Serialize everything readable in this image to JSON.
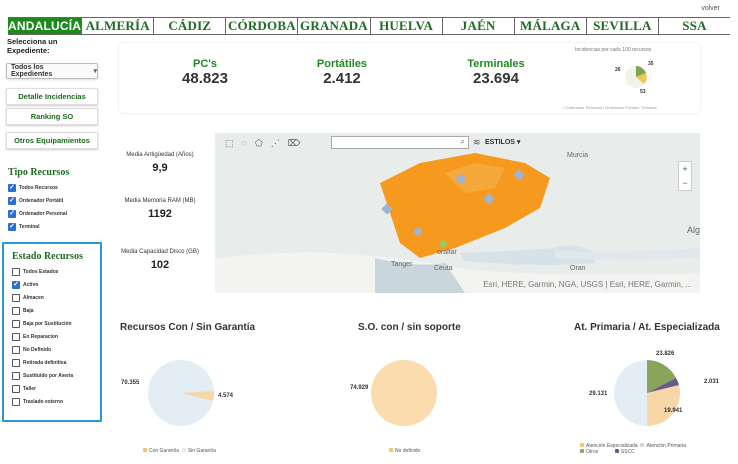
{
  "header": {
    "volver": "volver"
  },
  "tabs": [
    {
      "label": "ANDALUCÍA",
      "active": true
    },
    {
      "label": "ALMERÍA"
    },
    {
      "label": "CÁDIZ"
    },
    {
      "label": "CÓRDOBA"
    },
    {
      "label": "GRANADA"
    },
    {
      "label": "HUELVA"
    },
    {
      "label": "JAÉN"
    },
    {
      "label": "MÁLAGA"
    },
    {
      "label": "SEVILLA"
    },
    {
      "label": "SSA"
    }
  ],
  "sidebar": {
    "expediente_label": "Selecciona un Expediente:",
    "expediente_value": "Todos los Expedientes",
    "buttons": [
      "Detalle Incidencias",
      "Ranking SO",
      "Otros Equipamientos"
    ],
    "tipo_title": "Tipo Recursos",
    "tipo_items": [
      "Todos Recursos",
      "Ordenador Portátil",
      "Ordenador Personal",
      "Terminal"
    ],
    "estado_title": "Estado Recursos",
    "estado_items": [
      "Todos Estados",
      "Activo",
      "Almacen",
      "Baja",
      "Baja por Sustitución",
      "En Reparacion",
      "No Definido",
      "Retirada definitiva",
      "Sustituido por Avería",
      "Taller",
      "Traslado externo"
    ]
  },
  "kpis": [
    {
      "label": "PC's",
      "value": "48.823"
    },
    {
      "label": "Portátiles",
      "value": "2.412"
    },
    {
      "label": "Terminales",
      "value": "23.694"
    }
  ],
  "incidencias": {
    "title": "Incidencias por cada 100 recursos",
    "values": {
      "a": "35",
      "b": "26",
      "c": "53"
    },
    "legend": "• Ordenador Personal • Ordenador Portátil • Terminal"
  },
  "metrics": [
    {
      "label": "Media Antigüedad (Años)",
      "value": "9,9"
    },
    {
      "label": "Media Memoria RAM (MB)",
      "value": "1192"
    },
    {
      "label": "Media Capacidad Disco (GB)",
      "value": "102"
    }
  ],
  "map": {
    "estilos": "ESTILOS",
    "attribution": "Esri, HERE, Garmin, NGA, USGS | Esri, HERE, Garmin, ...",
    "labels": {
      "murcia": "Murcia",
      "tanger": "Tanger",
      "ceuta": "Ceuta",
      "oran": "Oran",
      "gibraltar": "oraltar",
      "alg": "Alg"
    }
  },
  "charts": {
    "garantia": {
      "title": "Recursos Con / Sin Garantía",
      "legend": [
        "Con Garantía",
        "Sin Garantía"
      ],
      "values": {
        "con": "70.355",
        "sin": "4.574"
      }
    },
    "soporte": {
      "title": "S.O. con / sin soporte",
      "legend": [
        "No definido"
      ],
      "values": {
        "nd": "74.929"
      }
    },
    "atencion": {
      "title": "At. Primaria / At. Especializada",
      "legend": [
        "Atención Especializada",
        "Atención Primaria",
        "Otros",
        "SSCC"
      ],
      "values": {
        "a": "23.826",
        "b": "2.031",
        "c": "29.131",
        "d": "19.941"
      }
    }
  },
  "chart_data": [
    {
      "type": "pie",
      "title": "Incidencias por cada 100 recursos",
      "categories": [
        "Ordenador Personal",
        "Ordenador Portátil",
        "Terminal"
      ],
      "values": [
        26,
        35,
        53
      ]
    },
    {
      "type": "pie",
      "title": "Recursos Con / Sin Garantía",
      "categories": [
        "Con Garantía",
        "Sin Garantía"
      ],
      "values": [
        70355,
        4574
      ]
    },
    {
      "type": "pie",
      "title": "S.O. con / sin soporte",
      "categories": [
        "No definido"
      ],
      "values": [
        74929
      ]
    },
    {
      "type": "pie",
      "title": "At. Primaria / At. Especializada",
      "categories": [
        "Atención Especializada",
        "Atención Primaria",
        "Otros",
        "SSCC"
      ],
      "values": [
        19941,
        29131,
        23826,
        2031
      ]
    }
  ],
  "colors": {
    "green": "#1f8a1f",
    "highlight": "#2a9ad6",
    "orange": "#f59a1e"
  }
}
